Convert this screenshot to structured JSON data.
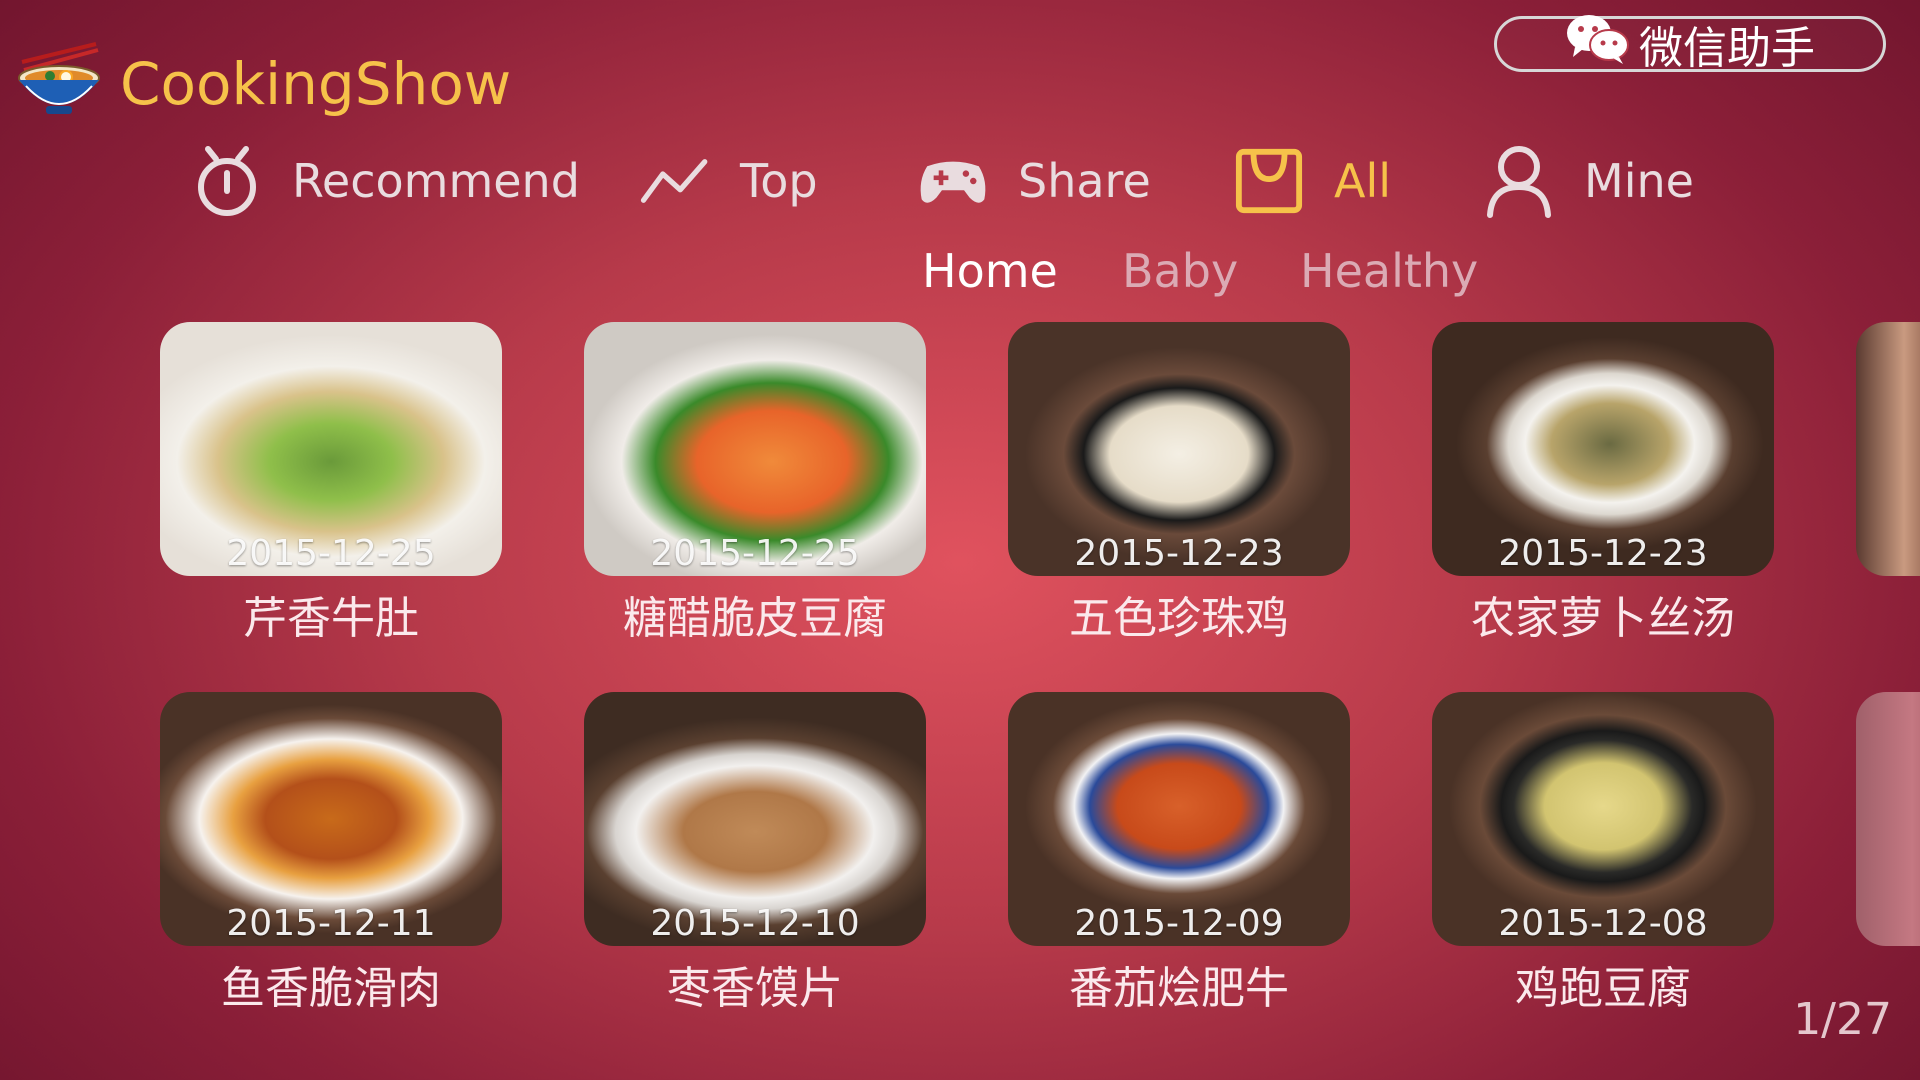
{
  "app": {
    "title": "CookingShow",
    "wechat_label": "微信助手"
  },
  "nav": [
    {
      "label": "Recommend",
      "icon": "stopwatch-icon",
      "active": false
    },
    {
      "label": "Top",
      "icon": "trend-line-icon",
      "active": false
    },
    {
      "label": "Share",
      "icon": "gamepad-icon",
      "active": false
    },
    {
      "label": "All",
      "icon": "bag-icon",
      "active": true
    },
    {
      "label": "Mine",
      "icon": "user-icon",
      "active": false
    }
  ],
  "sub_tabs": [
    {
      "label": "Home",
      "active": true
    },
    {
      "label": "Baby",
      "active": false
    },
    {
      "label": "Healthy",
      "active": false
    }
  ],
  "recipes": [
    {
      "date": "2015-12-25",
      "name": "芹香牛肚"
    },
    {
      "date": "2015-12-25",
      "name": "糖醋脆皮豆腐"
    },
    {
      "date": "2015-12-23",
      "name": "五色珍珠鸡"
    },
    {
      "date": "2015-12-23",
      "name": "农家萝卜丝汤"
    },
    {
      "date": "2015-12-11",
      "name": "鱼香脆滑肉"
    },
    {
      "date": "2015-12-10",
      "name": "枣香馍片"
    },
    {
      "date": "2015-12-09",
      "name": "番茄烩肥牛"
    },
    {
      "date": "2015-12-08",
      "name": "鸡跑豆腐"
    }
  ],
  "pagination": {
    "text": "1/27"
  },
  "colors": {
    "accent": "#f6c24a",
    "background": "#b73a4a"
  }
}
